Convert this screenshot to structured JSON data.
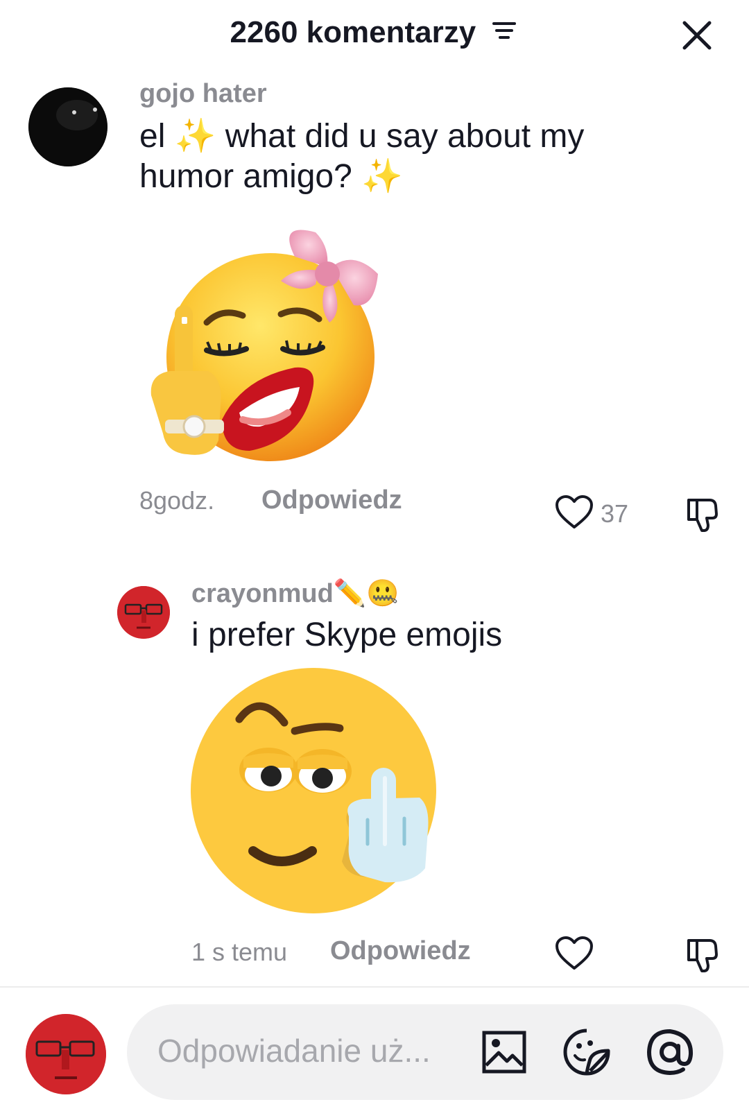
{
  "header": {
    "title": "2260 komentarzy",
    "filter_icon": "filter-icon",
    "close_icon": "close-icon"
  },
  "comments": [
    {
      "username": "gojo hater",
      "text_line1": "el ✨ what did u say about my",
      "text_line2": "humor amigo? ✨",
      "sticker": "sticker-sassy-bow-emoji",
      "time": "8godz.",
      "reply_label": "Odpowiedz",
      "like_count": "37"
    },
    {
      "username": "crayonmud",
      "username_emoji": "✏️🤐",
      "text": "i prefer Skype emojis",
      "sticker": "sticker-skype-emoji",
      "time": "1 s temu",
      "reply_label": "Odpowiedz"
    }
  ],
  "composer": {
    "placeholder": "Odpowiadanie uż...",
    "icons": [
      "image-icon",
      "sticker-icon",
      "mention-icon"
    ]
  },
  "colors": {
    "text": "#161823",
    "muted": "#8a8b91",
    "input_bg": "#f1f1f2"
  }
}
